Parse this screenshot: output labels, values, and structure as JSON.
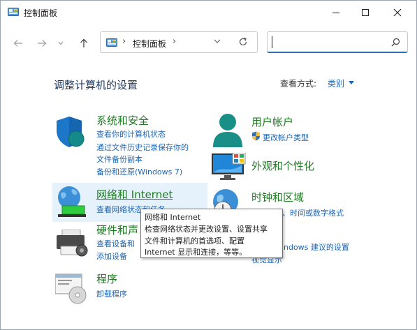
{
  "window": {
    "title": "控制面板"
  },
  "address": {
    "segment": "控制面板",
    "separator": "›"
  },
  "search": {
    "placeholder": ""
  },
  "heading": "调整计算机的设置",
  "view_by": {
    "label": "查看方式:",
    "value": "类别"
  },
  "categories": {
    "system_security": {
      "title": "系统和安全",
      "links": [
        "查看你的计算机状态",
        "通过文件历史记录保存你的",
        "文件备份副本",
        "备份和还原(Windows 7)"
      ]
    },
    "network": {
      "title": "网络和 Internet",
      "links": [
        "查看网络状态和任务"
      ]
    },
    "hardware": {
      "title": "硬件和声",
      "links": [
        "查看设备和",
        "添加设备"
      ]
    },
    "programs": {
      "title": "程序",
      "links": [
        "卸载程序"
      ]
    },
    "user_accounts": {
      "title": "用户帐户",
      "links": [
        "更改帐户类型"
      ]
    },
    "appearance": {
      "title": "外观和个性化",
      "links": []
    },
    "clock_region": {
      "title": "时钟和区域",
      "links": [
        "更改日期、时间或数字格式"
      ]
    },
    "ease_of_access": {
      "title": "用",
      "links": [
        "ndows 建议的设置",
        "视觉显示"
      ]
    }
  },
  "tooltip": {
    "lines": [
      "网络和 Internet",
      "检查网络状态并更改设置、设置共享",
      "文件和计算机的首选项、配置",
      "Internet 显示和连接，等等。"
    ]
  },
  "colors": {
    "accent": "#1d65b5",
    "category_title": "#1e7b22",
    "heading": "#1e3a5f",
    "hover": "#e5f1fb"
  }
}
